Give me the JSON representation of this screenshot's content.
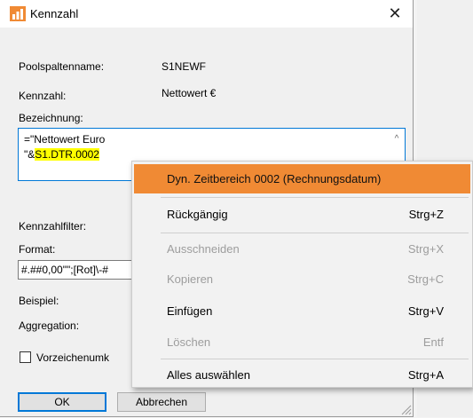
{
  "window": {
    "title": "Kennzahl",
    "close_glyph": "✕"
  },
  "fields": {
    "poolspaltenname_label": "Poolspaltenname:",
    "poolspaltenname_value": "S1NEWF",
    "kennzahl_label": "Kennzahl:",
    "kennzahl_value": "Nettowert €",
    "bezeichnung_label": "Bezeichnung:",
    "bezeichnung_line1": "=\"Nettowert Euro",
    "bezeichnung_line2_prefix": "\"&",
    "bezeichnung_line2_highlight": "S1.DTR.0002",
    "kennzahlfilter_label": "Kennzahlfilter:",
    "format_label": "Format:",
    "format_value": "#.##0,00\"\";[Rot]\\-#",
    "beispiel_label": "Beispiel:",
    "aggregation_label": "Aggregation:",
    "vorzeichen_label": "Vorzeichenumk"
  },
  "buttons": {
    "ok": "OK",
    "cancel": "Abbrechen"
  },
  "context_menu": {
    "highlight_color": "#f08a34",
    "items": [
      {
        "label": "Dyn. Zeitbereich 0002 (Rechnungsdatum)",
        "shortcut": "",
        "state": "highlighted"
      },
      {
        "label": "Rückgängig",
        "shortcut": "Strg+Z",
        "state": "enabled"
      },
      {
        "label": "Ausschneiden",
        "shortcut": "Strg+X",
        "state": "disabled"
      },
      {
        "label": "Kopieren",
        "shortcut": "Strg+C",
        "state": "disabled"
      },
      {
        "label": "Einfügen",
        "shortcut": "Strg+V",
        "state": "enabled"
      },
      {
        "label": "Löschen",
        "shortcut": "Entf",
        "state": "disabled"
      },
      {
        "label": "Alles auswählen",
        "shortcut": "Strg+A",
        "state": "enabled"
      }
    ]
  }
}
